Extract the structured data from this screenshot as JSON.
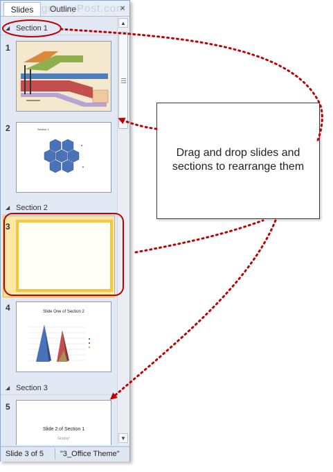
{
  "watermark": "groovyPost.com",
  "tabs": {
    "slides": "Slides",
    "outline": "Outline",
    "close": "×"
  },
  "sections": [
    {
      "name": "Section 1"
    },
    {
      "name": "Section 2"
    },
    {
      "name": "Section 3"
    }
  ],
  "slides": [
    {
      "number": "1"
    },
    {
      "number": "2",
      "title": "Section 1"
    },
    {
      "number": "3"
    },
    {
      "number": "4",
      "title": "Slide One of Section 2"
    },
    {
      "number": "5",
      "title": "Slide 2 of Section 1",
      "subtitle": "Groovy!"
    }
  ],
  "status": {
    "slide_position": "Slide 3 of 5",
    "theme": "\"3_Office Theme\""
  },
  "callout": {
    "text": "Drag and drop slides and sections to rearrange them"
  },
  "colors": {
    "annotation_red": "#c00000",
    "selection": "#f2c542",
    "panel": "#dde6f2"
  }
}
